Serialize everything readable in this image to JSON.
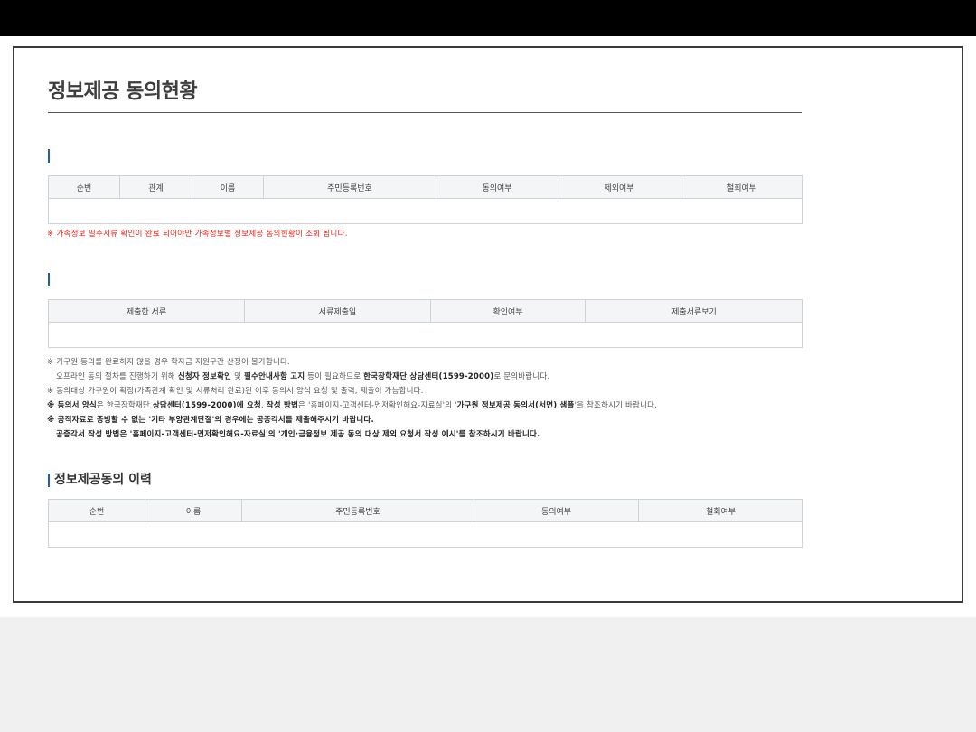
{
  "page": {
    "title": "정보제공 동의현황"
  },
  "consent_table": {
    "headers": [
      "순번",
      "관계",
      "이름",
      "주민등록번호",
      "동의여부",
      "제외여부",
      "철회여부"
    ],
    "notice": "※ 가족정보 필수서류 확인이 완료 되어야만 가족정보별 정보제공 동의현황이 조회 됩니다."
  },
  "documents_table": {
    "headers": [
      "제출한 서류",
      "서류제출일",
      "확인여부",
      "제출서류보기"
    ]
  },
  "notes": {
    "line1": "※ 가구원 동의를 완료하지 않을 경우 학자금 지원구간 산정이 불가합니다.",
    "line2_a": "오프라인 동의 절차를 진행하기 위해 ",
    "line2_b": "신청자 정보확인",
    "line2_c": " 및 ",
    "line2_d": "필수안내사항 고지",
    "line2_e": " 등이 필요하므로 ",
    "line2_f": "한국장학재단 상담센터(1599-2000)",
    "line2_g": "로 문의바랍니다.",
    "line3": "※ 동의대상 가구원이 확정(가족관계 확인 및 서류처리 완료)된 이후 동의서 양식 요청 및 출력, 제출이 가능합니다.",
    "line4_a": "※ 동의서 양식",
    "line4_b": "은 한국장학재단 ",
    "line4_c": "상담센터(1599-2000)에 요청",
    "line4_d": ", ",
    "line4_e": "작성 방법",
    "line4_f": "은 '홈페이지-고객센터-먼저확인해요-자료실'의 '",
    "line4_g": "가구원 정보제공 동의서(서면) 샘플",
    "line4_h": "'을 참조하시기 바랍니다.",
    "line5": "※ 공적자료로 증빙할 수 없는 '기타 부양관계단절'의 경우에는 공증각서를 제출해주시기 바랍니다.",
    "line6": "공증각서 작성 방법은 '홈페이지-고객센터-먼저확인해요-자료실'의 '개인·금융정보 제공 동의 대상 제외 요청서 작성 예시'를 참조하시기 바랍니다."
  },
  "history": {
    "title": "정보제공동의 이력",
    "headers": [
      "순번",
      "이름",
      "주민등록번호",
      "동의여부",
      "철회여부"
    ]
  }
}
